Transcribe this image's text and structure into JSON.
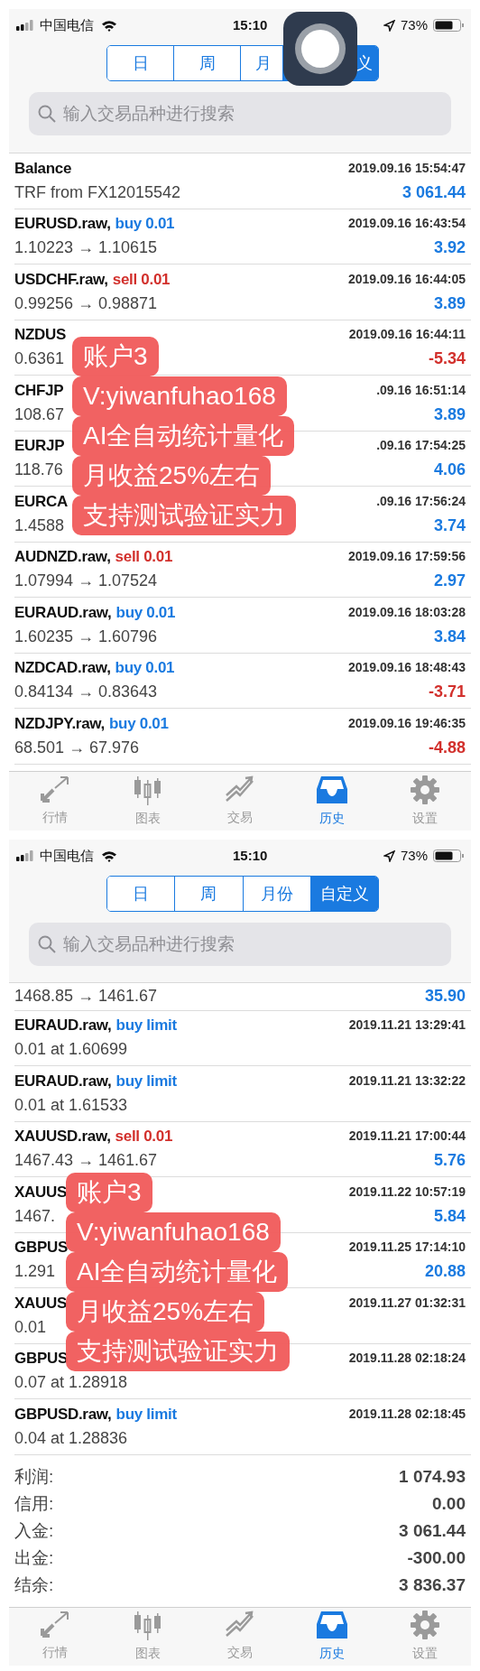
{
  "screens": [
    {
      "status_bar": {
        "carrier": "中国电信",
        "time": "15:10",
        "battery": "73%"
      },
      "assistive_touch": true,
      "period_tabs": [
        {
          "label": "日",
          "selected": false
        },
        {
          "label": "周",
          "selected": false
        },
        {
          "label": "月",
          "selected": false
        },
        {
          "label": "义",
          "selected": true
        }
      ],
      "search": {
        "placeholder": "输入交易品种进行搜索"
      },
      "rows": [
        {
          "symbol": "Balance",
          "detail": "TRF from FX12015542",
          "time": "2019.09.16 15:54:47",
          "profit": "3 061.44",
          "is_loss": false
        },
        {
          "symbol": "EURUSD.raw,",
          "action": "buy 0.01",
          "is_sell": false,
          "detail": "1.10223 → 1.10615",
          "time": "2019.09.16 16:43:54",
          "profit": "3.92",
          "is_loss": false
        },
        {
          "symbol": "USDCHF.raw,",
          "action": "sell 0.01",
          "is_sell": true,
          "detail": "0.99256 → 0.98871",
          "time": "2019.09.16 16:44:05",
          "profit": "3.89",
          "is_loss": false
        },
        {
          "symbol": "NZDUS",
          "detail": "0.6361",
          "time": "2019.09.16 16:44:11",
          "profit": "-5.34",
          "is_loss": true
        },
        {
          "symbol": "CHFJP",
          "detail": "108.67",
          "time": ".09.16 16:51:14",
          "profit": "3.89",
          "is_loss": false
        },
        {
          "symbol": "EURJP",
          "detail": "118.76",
          "time": ".09.16 17:54:25",
          "profit": "4.06",
          "is_loss": false
        },
        {
          "symbol": "EURCA",
          "detail": "1.4588",
          "time": ".09.16 17:56:24",
          "profit": "3.74",
          "is_loss": false
        },
        {
          "symbol": "AUDNZD.raw,",
          "action": "sell 0.01",
          "is_sell": true,
          "detail": "1.07994 → 1.07524",
          "time": "2019.09.16 17:59:56",
          "profit": "2.97",
          "is_loss": false
        },
        {
          "symbol": "EURAUD.raw,",
          "action": "buy 0.01",
          "is_sell": false,
          "detail": "1.60235 → 1.60796",
          "time": "2019.09.16 18:03:28",
          "profit": "3.84",
          "is_loss": false
        },
        {
          "symbol": "NZDCAD.raw,",
          "action": "buy 0.01",
          "is_sell": false,
          "detail": "0.84134 → 0.83643",
          "time": "2019.09.16 18:48:43",
          "profit": "-3.71",
          "is_loss": true
        },
        {
          "symbol": "NZDJPY.raw,",
          "action": "buy 0.01",
          "is_sell": false,
          "detail": "68.501 → 67.976",
          "time": "2019.09.16 19:46:35",
          "profit": "-4.88",
          "is_loss": true
        }
      ],
      "tab_bar": [
        {
          "label": "行情",
          "selected": false
        },
        {
          "label": "图表",
          "selected": false
        },
        {
          "label": "交易",
          "selected": false
        },
        {
          "label": "历史",
          "selected": true
        },
        {
          "label": "设置",
          "selected": false
        }
      ],
      "overlay": {
        "lines": [
          "账户3",
          "V:yiwanfuhao168",
          "AI全自动统计量化",
          "月收益25%左右",
          "支持测试验证实力"
        ]
      }
    },
    {
      "status_bar": {
        "carrier": "中国电信",
        "time": "15:10",
        "battery": "73%"
      },
      "period_tabs": [
        {
          "label": "日",
          "selected": false
        },
        {
          "label": "周",
          "selected": false
        },
        {
          "label": "月份",
          "selected": false
        },
        {
          "label": "自定义",
          "selected": true
        }
      ],
      "search": {
        "placeholder": "输入交易品种进行搜索"
      },
      "rows": [
        {
          "detail": "1468.85 → 1461.67",
          "profit": "35.90",
          "is_loss": false
        },
        {
          "symbol": "EURAUD.raw,",
          "action": "buy limit",
          "is_sell": false,
          "detail": "0.01 at 1.60699",
          "time": "2019.11.21 13:29:41"
        },
        {
          "symbol": "EURAUD.raw,",
          "action": "buy limit",
          "is_sell": false,
          "detail": "0.01 at 1.61533",
          "time": "2019.11.21 13:32:22"
        },
        {
          "symbol": "XAUUSD.raw,",
          "action": "sell 0.01",
          "is_sell": true,
          "detail": "1467.43 → 1461.67",
          "time": "2019.11.21 17:00:44",
          "profit": "5.76",
          "is_loss": false
        },
        {
          "symbol": "XAUUS",
          "detail": "1467.",
          "time": "2019.11.22 10:57:19",
          "profit": "5.84",
          "is_loss": false
        },
        {
          "symbol": "GBPUS",
          "detail": "1.291",
          "time": "2019.11.25 17:14:10",
          "profit": "20.88",
          "is_loss": false
        },
        {
          "symbol": "XAUUS",
          "detail": "0.01",
          "time": "2019.11.27 01:32:31"
        },
        {
          "symbol": "GBPUS",
          "detail": "0.07 at 1.28918",
          "time": "2019.11.28 02:18:24"
        },
        {
          "symbol": "GBPUSD.raw,",
          "action": "buy limit",
          "is_sell": false,
          "detail": "0.04 at 1.28836",
          "time": "2019.11.28 02:18:45"
        }
      ],
      "summary": [
        {
          "label": "利润:",
          "value": "1 074.93"
        },
        {
          "label": "信用:",
          "value": "0.00"
        },
        {
          "label": "入金:",
          "value": "3 061.44"
        },
        {
          "label": "出金:",
          "value": "-300.00"
        },
        {
          "label": "结余:",
          "value": "3 836.37"
        }
      ],
      "tab_bar": [
        {
          "label": "行情",
          "selected": false
        },
        {
          "label": "图表",
          "selected": false
        },
        {
          "label": "交易",
          "selected": false
        },
        {
          "label": "历史",
          "selected": true
        },
        {
          "label": "设置",
          "selected": false
        }
      ],
      "overlay": {
        "lines": [
          "账户3",
          "V:yiwanfuhao168",
          "AI全自动统计量化",
          "月收益25%左右",
          "支持测试验证实力"
        ]
      }
    }
  ]
}
